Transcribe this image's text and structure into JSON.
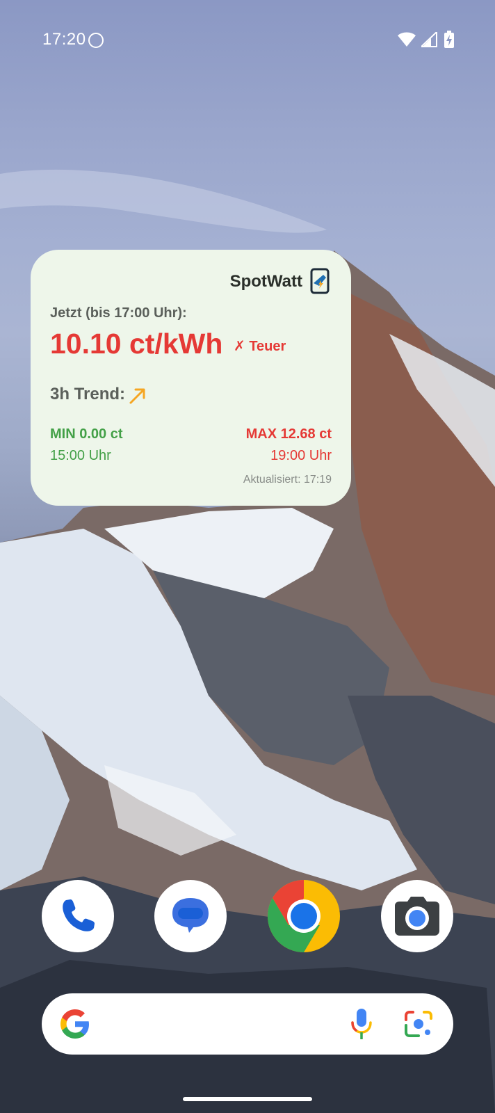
{
  "status_bar": {
    "time": "17:20",
    "icons": [
      "wifi-icon",
      "signal-icon",
      "battery-charging-icon"
    ]
  },
  "widget": {
    "app_name": "SpotWatt",
    "now_label": "Jetzt (bis 17:00 Uhr):",
    "price": "10.10 ct/kWh",
    "price_tag": "✗ Teuer",
    "trend_label": "3h Trend:",
    "trend_icon": "arrow-up-right-icon",
    "min_label": "MIN 0.00 ct",
    "min_time": "15:00 Uhr",
    "max_label": "MAX 12.68 ct",
    "max_time": "19:00 Uhr",
    "updated": "Aktualisiert: 17:19",
    "colors": {
      "expensive": "#e53935",
      "cheap": "#43a047",
      "trend": "#f5a623",
      "background": "#eef6ea"
    }
  },
  "dock": {
    "apps": [
      "phone-icon",
      "messages-icon",
      "chrome-icon",
      "camera-icon"
    ]
  },
  "search": {
    "icons": [
      "google-icon",
      "mic-icon",
      "lens-icon"
    ]
  }
}
